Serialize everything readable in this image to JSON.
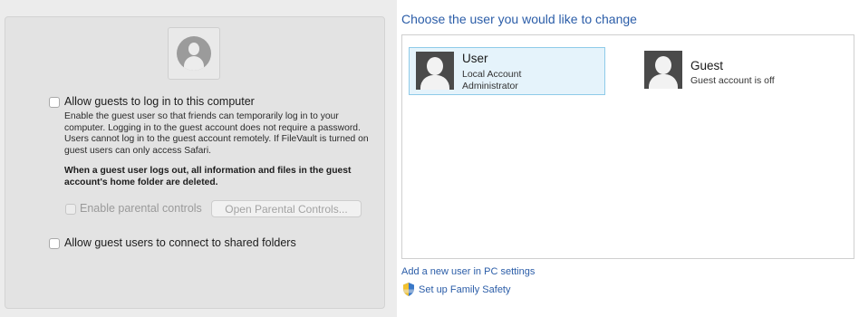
{
  "mac": {
    "allow_guests_label": "Allow guests to log in to this computer",
    "allow_guests_checked": false,
    "description": "Enable the guest user so that friends can temporarily log in to your computer. Logging in to the guest account does not require a password. Users cannot log in to the guest account remotely. If FileVault is turned on guest users can only access Safari.",
    "warning": "When a guest user logs out, all information and files in the guest account's home folder are deleted.",
    "parental_controls_label": "Enable parental controls",
    "parental_controls_checked": false,
    "open_parental_controls_button": "Open Parental Controls...",
    "shared_folders_label": "Allow guest users to connect to shared folders",
    "shared_folders_checked": false
  },
  "windows": {
    "title": "Choose the user you would like to change",
    "users": [
      {
        "name": "User",
        "line1": "Local Account",
        "line2": "Administrator",
        "selected": true
      },
      {
        "name": "Guest",
        "line1": "Guest account is off",
        "line2": "",
        "selected": false
      }
    ],
    "add_user_link": "Add a new user in PC settings",
    "family_safety_link": "Set up Family Safety"
  },
  "icons": {
    "mac_avatar": "user-silhouette-icon",
    "win_user_pic": "user-tile-icon",
    "family_safety": "uac-shield-icon"
  }
}
